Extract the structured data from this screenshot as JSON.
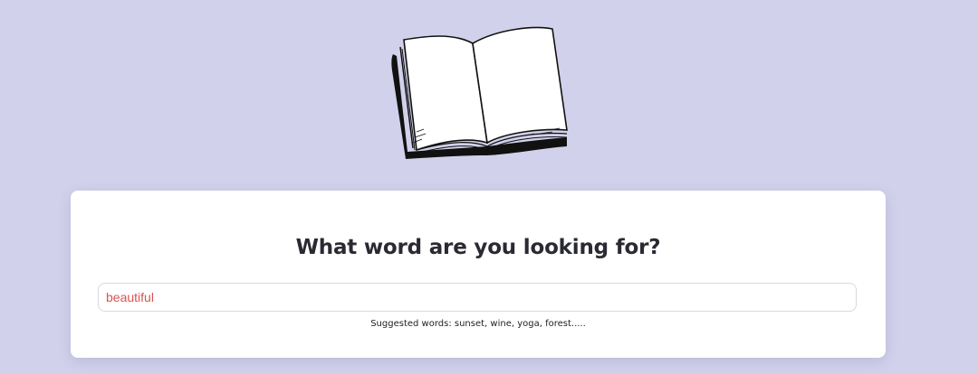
{
  "search": {
    "heading": "What word are you looking for?",
    "value": "beautiful",
    "suggestion_text": "Suggested words: sunset, wine, yoga, forest....."
  },
  "illustration": {
    "icon": "open-book-icon"
  },
  "colors": {
    "background": "#d1d1eb",
    "card": "#ffffff",
    "input_text": "#d9534f",
    "heading": "#2a2a33"
  }
}
